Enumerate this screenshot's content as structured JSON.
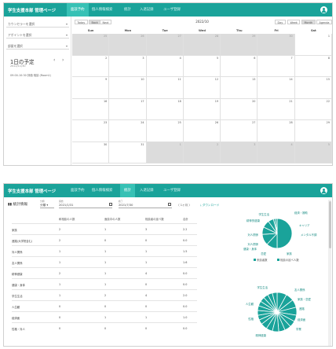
{
  "colors": {
    "brand": "#1aa39a",
    "brand_light": "#37c1b5",
    "grey_cell": "#dcdcdc"
  },
  "app": {
    "brand": "学生支援本部 管理ページ",
    "tabs": [
      "面談予約",
      "個人情報検索",
      "統計",
      "入退記録",
      "ユーザ登録"
    ],
    "user_icon": "account-circle-icon"
  },
  "calendar": {
    "counselor_select": "カウンセラーを選択",
    "appointment_select": "アポイントを選択",
    "facility_select": "部屋を選択",
    "today_title": "1日の予定",
    "today_date": "2022/11/30",
    "today_event": "09:00-10:30 評価 相談 (Room1)",
    "prev": "‹",
    "next": "›",
    "toolbar_left": [
      "Today",
      "Back",
      "Next"
    ],
    "toolbar_right": [
      "Day",
      "Week",
      "Month",
      "Agenda"
    ],
    "month_title": "2022/10",
    "weekdays": [
      "Sun",
      "Mon",
      "Tue",
      "Wed",
      "Thu",
      "Fri",
      "Sat"
    ],
    "weeks": [
      [
        "25",
        "26",
        "27",
        "28",
        "29",
        "30",
        "1"
      ],
      [
        "2",
        "3",
        "4",
        "5",
        "6",
        "7",
        "8"
      ],
      [
        "9",
        "10",
        "11",
        "12",
        "13",
        "14",
        "15"
      ],
      [
        "16",
        "17",
        "18",
        "19",
        "20",
        "21",
        "22"
      ],
      [
        "23",
        "24",
        "25",
        "26",
        "27",
        "28",
        "29"
      ],
      [
        "30",
        "31",
        "1",
        "2",
        "3",
        "4",
        "5"
      ]
    ],
    "outside_cells": [
      [
        0,
        0
      ],
      [
        0,
        1
      ],
      [
        0,
        2
      ],
      [
        0,
        3
      ],
      [
        0,
        4
      ],
      [
        0,
        5
      ],
      [
        5,
        2
      ],
      [
        5,
        3
      ],
      [
        5,
        4
      ],
      [
        5,
        5
      ],
      [
        5,
        6
      ]
    ]
  },
  "stats": {
    "title": "統計情報",
    "filter_type_label": "分類",
    "filter_type_value": "分類",
    "start_label": "開始",
    "start_value": "2021/1/31",
    "end_label": "終了",
    "end_value": "2021/7/30",
    "range_text": "〈 1ヶ月 〉",
    "download": "ダウンロード",
    "columns": [
      "",
      "和相談の人数",
      "面談中の人数",
      "相談者の延べ数",
      "合計"
    ],
    "rows": [
      [
        "家族",
        "2",
        "1",
        "3",
        "2.2"
      ],
      [
        "進路(大学院含む)",
        "2",
        "0",
        "0",
        "0.0"
      ],
      [
        "対人関係",
        "1",
        "1",
        "1",
        "1.5"
      ],
      [
        "友人関係",
        "1",
        "1",
        "1",
        "1.6"
      ],
      [
        "精神健康",
        "2",
        "1",
        "4",
        "0.0"
      ],
      [
        "健康・身体",
        "1",
        "1",
        "0",
        "0.0"
      ],
      [
        "学生生活",
        "1",
        "2",
        "4",
        "2.0"
      ],
      [
        "人生観",
        "0",
        "0",
        "0",
        "0.0"
      ],
      [
        "経済面",
        "0",
        "1",
        "1",
        "1.0"
      ],
      [
        "性格・対人",
        "0",
        "0",
        "0",
        "0.0"
      ]
    ],
    "legend": [
      "来談者数",
      "相談の延べ人数"
    ],
    "pie1_labels": [
      "学生生活",
      "経済・援助",
      "精神的健康",
      "キャリア",
      "メンタル不調",
      "対人関係",
      "対人関係",
      "家族",
      "恋愛",
      "健康・身体"
    ],
    "pie1_values": [
      50,
      12,
      12,
      8,
      8,
      6,
      2,
      2
    ],
    "pie2_labels": [
      "学生生活",
      "友人関係",
      "家族・恋愛",
      "進路",
      "経済面",
      "学業",
      "精神健康",
      "人生観",
      "性格"
    ],
    "pie2_values": [
      6,
      5,
      5,
      5,
      4,
      4,
      4,
      4,
      4,
      4,
      4,
      3,
      3,
      3,
      3,
      3,
      3,
      3,
      3,
      3
    ]
  }
}
